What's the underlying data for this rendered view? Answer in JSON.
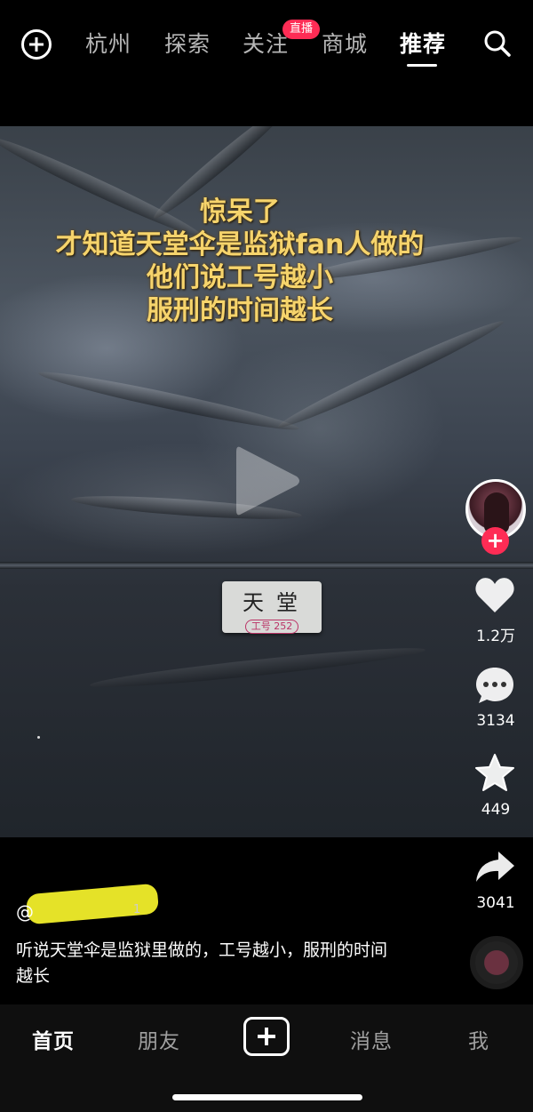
{
  "top_nav": {
    "tabs": [
      "杭州",
      "探索",
      "关注",
      "商城",
      "推荐"
    ],
    "active_tab": "推荐",
    "live_badge": "直播",
    "icons": [
      "add-circle-icon",
      "search-icon"
    ]
  },
  "video": {
    "caption_lines": [
      "惊呆了",
      "才知道天堂伞是监狱fan人做的",
      "他们说工号越小",
      "服刑的时间越长"
    ],
    "label_brand": "天堂",
    "label_number": "工号 252",
    "caption_color": "#f6d46c"
  },
  "actions": {
    "likes": "1.2万",
    "comments": "3134",
    "favorites": "449",
    "shares": "3041"
  },
  "post": {
    "author": "@",
    "author_suffix": "1",
    "description": "听说天堂伞是监狱里做的，工号越小，服刑的时间越长"
  },
  "bottom_nav": {
    "home": "首页",
    "friends": "朋友",
    "messages": "消息",
    "me": "我"
  },
  "colors": {
    "accent": "#fe2c55",
    "background": "#000000"
  }
}
